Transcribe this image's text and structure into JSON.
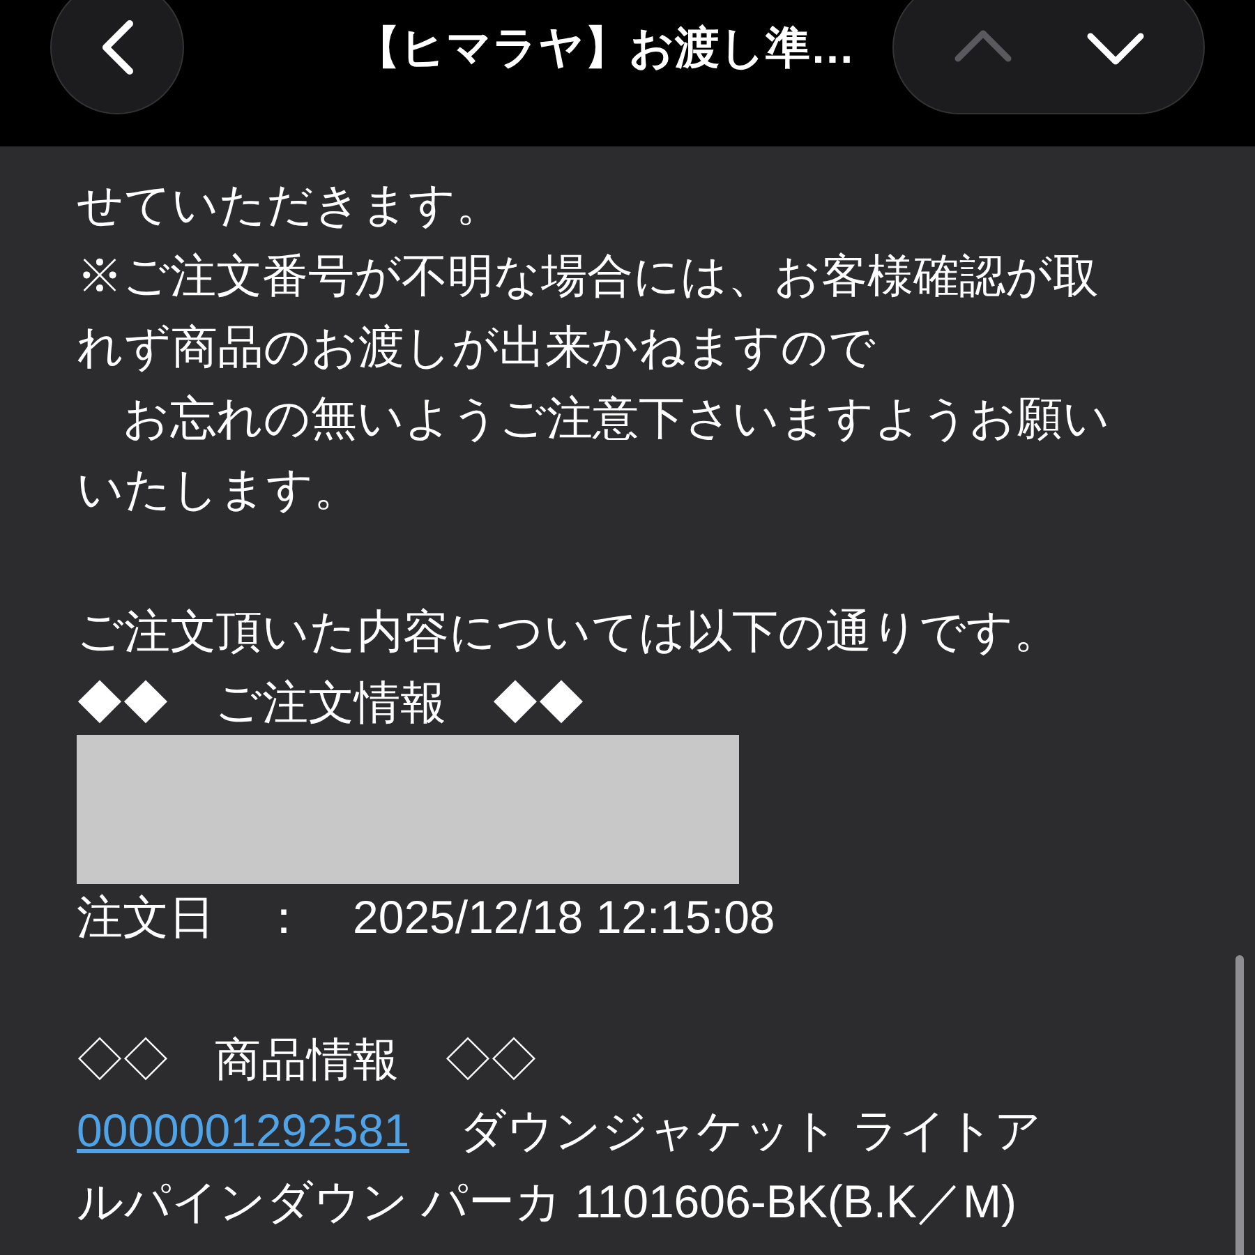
{
  "header": {
    "title": "【ヒマラヤ】お渡し準…",
    "nav": {
      "up_enabled": false,
      "down_enabled": true
    }
  },
  "body": [
    {
      "kind": "text",
      "text": "せていただきます。"
    },
    {
      "kind": "text",
      "text": "※ご注文番号が不明な場合には、お客様確認が取"
    },
    {
      "kind": "text",
      "text": "れず商品のお渡しが出来かねますので"
    },
    {
      "kind": "text",
      "text": "　お忘れの無いようご注意下さいますようお願い"
    },
    {
      "kind": "text",
      "text": "いたします。"
    },
    {
      "kind": "blank"
    },
    {
      "kind": "text",
      "text": "ご注文頂いた内容については以下の通りです。"
    },
    {
      "kind": "text",
      "text": "◆◆　ご注文情報　◆◆"
    },
    {
      "kind": "redacted"
    },
    {
      "kind": "text",
      "text": "注文日　：　2025/12/18 12:15:08"
    },
    {
      "kind": "blank"
    },
    {
      "kind": "text",
      "text": "◇◇　商品情報　◇◇"
    },
    {
      "kind": "product",
      "code": "0000001292581",
      "text": "ダウンジャケット ライトア"
    },
    {
      "kind": "text",
      "text": "ルパインダウン パーカ 1101606-BK(B.K／M)"
    }
  ]
}
